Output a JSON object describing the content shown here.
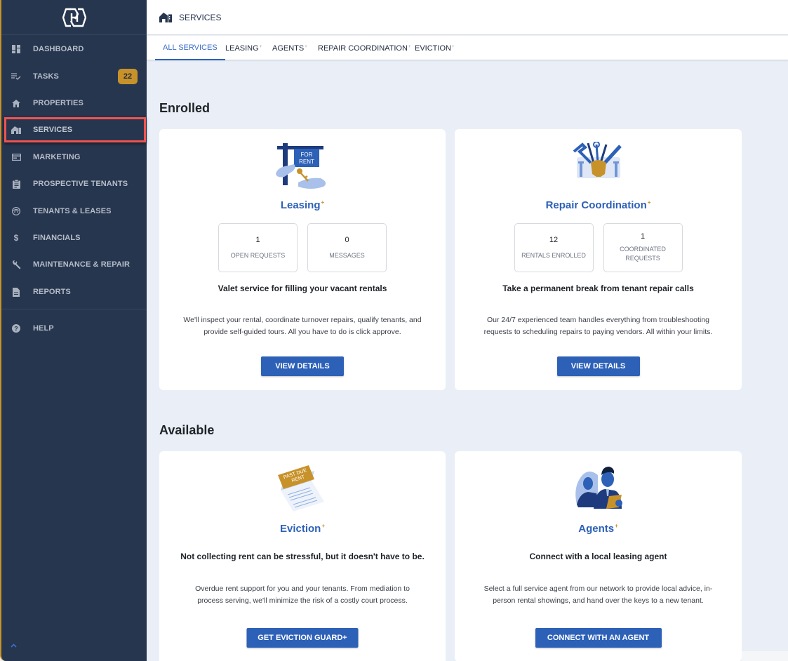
{
  "sidebar": {
    "items": [
      {
        "label": "DASHBOARD",
        "icon": "dashboard-icon"
      },
      {
        "label": "TASKS",
        "icon": "tasks-icon",
        "badge": "22"
      },
      {
        "label": "PROPERTIES",
        "icon": "home-icon"
      },
      {
        "label": "SERVICES",
        "icon": "services-icon",
        "active": true
      },
      {
        "label": "MARKETING",
        "icon": "marketing-icon"
      },
      {
        "label": "PROSPECTIVE TENANTS",
        "icon": "clipboard-icon"
      },
      {
        "label": "TENANTS & LEASES",
        "icon": "tenant-face-icon"
      },
      {
        "label": "FINANCIALS",
        "icon": "dollar-icon"
      },
      {
        "label": "MAINTENANCE & REPAIR",
        "icon": "wrench-icon"
      },
      {
        "label": "REPORTS",
        "icon": "document-icon"
      },
      {
        "label": "HELP",
        "icon": "help-icon"
      }
    ]
  },
  "header": {
    "title": "SERVICES"
  },
  "tabs": [
    {
      "label": "ALL SERVICES",
      "plus": "",
      "active": true
    },
    {
      "label": "LEASING",
      "plus": "+"
    },
    {
      "label": "AGENTS",
      "plus": "+"
    },
    {
      "label": "REPAIR COORDINATION",
      "plus": "+"
    },
    {
      "label": "EVICTION",
      "plus": "+"
    }
  ],
  "sections": {
    "enrolled": "Enrolled",
    "available": "Available"
  },
  "cards": {
    "leasing": {
      "title": "Leasing",
      "plus": "+",
      "illustration": "for-rent-sign-illustration",
      "sign_text": [
        "FOR",
        "RENT"
      ],
      "stats": [
        {
          "value": "1",
          "label": "OPEN REQUESTS"
        },
        {
          "value": "0",
          "label": "MESSAGES"
        }
      ],
      "tagline": "Valet service for filling your vacant rentals",
      "description": "We'll inspect your rental, coordinate turnover repairs, qualify tenants, and provide self-guided tours. All you have to do is click approve.",
      "button": "VIEW DETAILS"
    },
    "repair": {
      "title": "Repair Coordination",
      "plus": "+",
      "illustration": "toolbox-illustration",
      "stats": [
        {
          "value": "12",
          "label": "RENTALS ENROLLED"
        },
        {
          "value": "1",
          "label": "COORDINATED REQUESTS"
        }
      ],
      "tagline": "Take a permanent break from tenant repair calls",
      "description": "Our 24/7 experienced team handles everything from troubleshooting requests to scheduling repairs to paying vendors. All within your limits.",
      "button": "VIEW DETAILS"
    },
    "eviction": {
      "title": "Eviction",
      "plus": "+",
      "illustration": "past-due-rent-illustration",
      "notice_text": [
        "PAST DUE",
        "RENT"
      ],
      "tagline": "Not collecting rent can be stressful, but it doesn't have to be.",
      "description": "Overdue rent support for you and your tenants. From mediation to process serving, we'll minimize the risk of a costly court process.",
      "button": "GET EVICTION GUARD+"
    },
    "agents": {
      "title": "Agents",
      "plus": "+",
      "illustration": "agents-illustration",
      "tagline": "Connect with a local leasing agent",
      "description": "Select a full service agent from our network to provide local advice, in-person rental showings, and hand over the keys to a new tenant.",
      "button": "CONNECT WITH AN AGENT"
    }
  },
  "colors": {
    "sidebar_bg": "#27364f",
    "accent_blue": "#2d61b8",
    "accent_gold": "#c8922a",
    "active_outline": "#ef5350",
    "page_bg": "#eaeff7"
  }
}
